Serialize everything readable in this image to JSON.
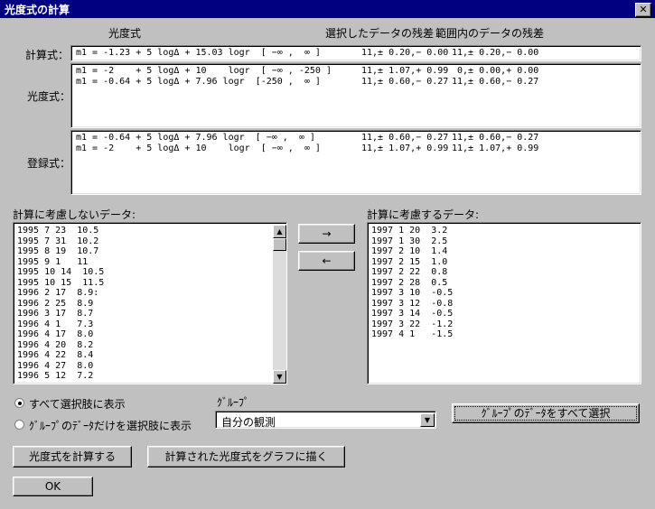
{
  "window": {
    "title": "光度式の計算",
    "close": "✕"
  },
  "headers": {
    "formula": "光度式",
    "sel_residual": "選択したデータの残差",
    "range_residual": "範囲内のデータの残差"
  },
  "calc": {
    "label": "計算式：",
    "formula": "m1 = -1.23 + 5 logΔ + 15.03 logr  [ −∞ ,  ∞ ]",
    "sel": "11,± 0.20,− 0.00",
    "rng": "11,± 0.20,− 0.00"
  },
  "photometric": {
    "label": "光度式：",
    "rows": [
      {
        "formula": "m1 = -2    + 5 logΔ + 10    logr  [ −∞ , -250 ]",
        "sel": "11,± 1.07,+ 0.99",
        "rng": " 0,± 0.00,+ 0.00"
      },
      {
        "formula": "m1 = -0.64 + 5 logΔ + 7.96 logr  [-250 ,  ∞ ]",
        "sel": "11,± 0.60,− 0.27",
        "rng": "11,± 0.60,− 0.27"
      }
    ]
  },
  "registered": {
    "label": "登録式：",
    "rows": [
      {
        "formula": "m1 = -0.64 + 5 logΔ + 7.96 logr  [ −∞ ,  ∞ ]",
        "sel": "11,± 0.60,− 0.27",
        "rng": "11,± 0.60,− 0.27"
      },
      {
        "formula": "m1 = -2    + 5 logΔ + 10    logr  [ −∞ ,  ∞ ]",
        "sel": "11,± 1.07,+ 0.99",
        "rng": "11,± 1.07,+ 0.99"
      }
    ]
  },
  "excluded": {
    "label": "計算に考慮しないデータ:",
    "items": [
      "1995 7 23  10.5",
      "1995 7 31  10.2",
      "1995 8 19  10.7",
      "1995 9 1   11",
      "1995 10 14  10.5",
      "1995 10 15  11.5",
      "1996 2 17  8.9:",
      "1996 2 25  8.9",
      "1996 3 17  8.7",
      "1996 4 1   7.3",
      "1996 4 17  8.0",
      "1996 4 20  8.2",
      "1996 4 22  8.4",
      "1996 4 27  8.0",
      "1996 5 12  7.2"
    ]
  },
  "included": {
    "label": "計算に考慮するデータ:",
    "items": [
      "1997 1 20  3.2",
      "1997 1 30  2.5",
      "1997 2 10  1.4",
      "1997 2 15  1.0",
      "1997 2 22  0.8",
      "1997 2 28  0.5",
      "1997 3 10  -0.5",
      "1997 3 12  -0.8",
      "1997 3 14  -0.5",
      "1997 3 22  -1.2",
      "1997 4 1   -1.5"
    ]
  },
  "move_buttons": {
    "right": "→",
    "left": "←"
  },
  "options": {
    "show_all": "すべて選択肢に表示",
    "show_group": "ｸﾞﾙｰﾌﾟのﾃﾞｰﾀだけを選択肢に表示",
    "selected": "show_all"
  },
  "group": {
    "label": "ｸﾞﾙｰﾌﾟ",
    "value": "自分の観測",
    "select_all_button": "ｸﾞﾙｰﾌﾟのﾃﾞｰﾀをすべて選択"
  },
  "buttons": {
    "compute": "光度式を計算する",
    "plot": "計算された光度式をグラフに描く",
    "ok": "OK"
  },
  "scroll": {
    "up": "▲",
    "down": "▼",
    "dropdown": "▼"
  }
}
